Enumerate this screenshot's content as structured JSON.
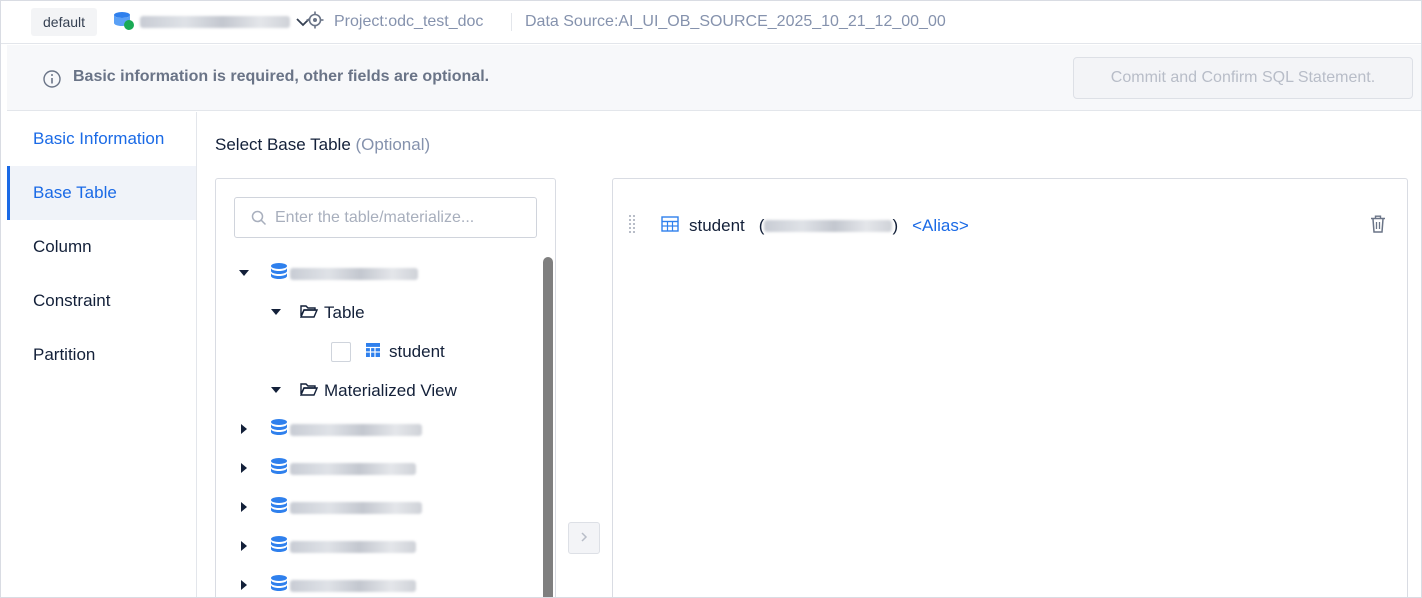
{
  "topbar": {
    "env": "default",
    "project": "Project:odc_test_doc",
    "data_source": "Data Source:AI_UI_OB_SOURCE_2025_10_21_12_00_00"
  },
  "info": {
    "message": "Basic information is required, other fields are optional.",
    "commit_label": "Commit and Confirm SQL Statement."
  },
  "sidenav": {
    "items": [
      {
        "label": "Basic Information"
      },
      {
        "label": "Base Table"
      },
      {
        "label": "Column"
      },
      {
        "label": "Constraint"
      },
      {
        "label": "Partition"
      }
    ],
    "active": "Base Table"
  },
  "base_table": {
    "title": "Select Base Table",
    "optional": "(Optional)",
    "search_placeholder": "Enter the table/materialize...",
    "tree": {
      "folder_table": "Table",
      "table_item": "student",
      "folder_mview": "Materialized View"
    },
    "selected": {
      "table": "student",
      "open_paren": "(",
      "close_paren": ")",
      "alias": "<Alias>"
    }
  },
  "colors": {
    "accent": "#1a6ae6",
    "text": "#132039",
    "muted": "#8592ad"
  }
}
